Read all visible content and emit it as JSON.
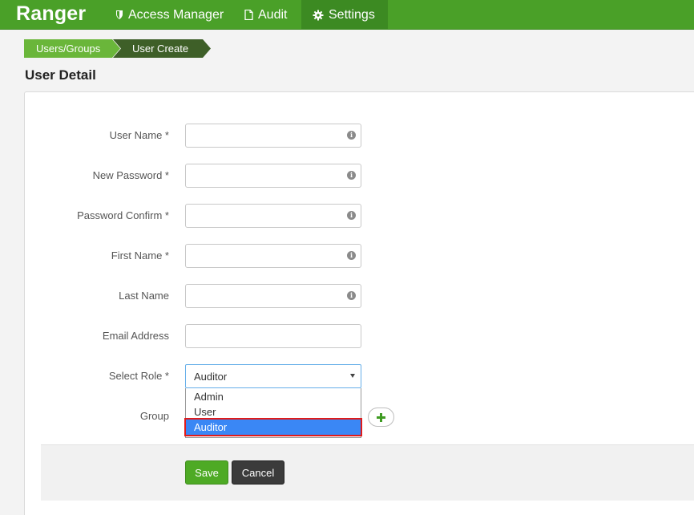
{
  "header": {
    "brand": "Ranger",
    "nav": [
      {
        "label": "Access Manager",
        "icon": "shield-icon"
      },
      {
        "label": "Audit",
        "icon": "file-icon"
      },
      {
        "label": "Settings",
        "icon": "gear-icon",
        "active": true
      }
    ]
  },
  "breadcrumb": [
    "Users/Groups",
    "User Create"
  ],
  "page": {
    "title": "User Detail"
  },
  "form": {
    "fields": [
      {
        "label": "User Name *",
        "value": "",
        "has_info": true
      },
      {
        "label": "New Password *",
        "value": "",
        "has_info": true
      },
      {
        "label": "Password Confirm *",
        "value": "",
        "has_info": true
      },
      {
        "label": "First Name *",
        "value": "",
        "has_info": true
      },
      {
        "label": "Last Name",
        "value": "",
        "has_info": true
      },
      {
        "label": "Email Address",
        "value": "",
        "has_info": false
      }
    ],
    "role": {
      "label": "Select Role *",
      "selected": "Auditor",
      "options": [
        "Admin",
        "User",
        "Auditor"
      ]
    },
    "group": {
      "label": "Group"
    }
  },
  "buttons": {
    "save": "Save",
    "cancel": "Cancel"
  },
  "colors": {
    "nav_bg": "#4aa028",
    "nav_active": "#3c8a22",
    "highlight": "#3a87f5",
    "annotation": "#e01b1b",
    "save": "#4eaa25"
  }
}
